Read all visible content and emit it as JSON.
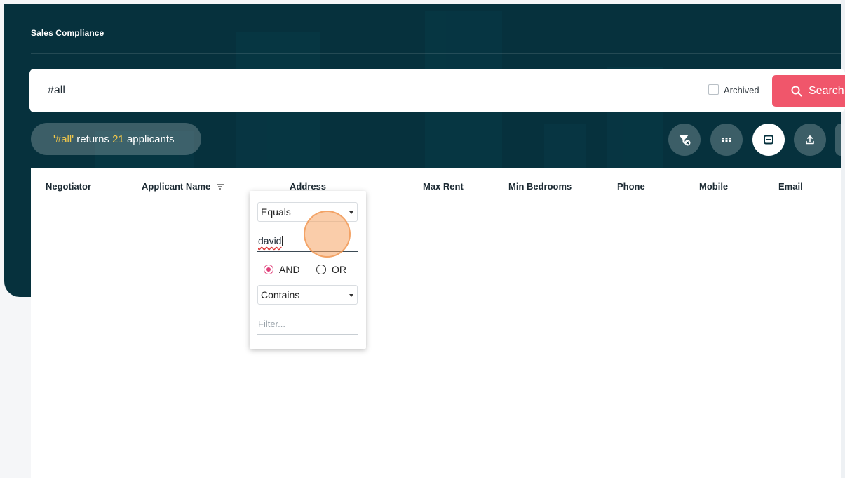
{
  "page": {
    "title": "Sales Compliance"
  },
  "search": {
    "query": "#all",
    "archived_label": "Archived",
    "button_label": "Search"
  },
  "result": {
    "query_text": "'#all'",
    "middle": " returns ",
    "count": "21",
    "suffix": " applicants"
  },
  "table": {
    "columns": [
      "Negotiator",
      "Applicant Name",
      "Address",
      "Max Rent",
      "Min Bedrooms",
      "Phone",
      "Mobile",
      "Email"
    ]
  },
  "filter": {
    "condition1": "Equals",
    "value1": "david",
    "and_label": "AND",
    "or_label": "OR",
    "condition2": "Contains",
    "value2_placeholder": "Filter..."
  },
  "colors": {
    "header_bg": "#06313d",
    "accent": "#f0566b",
    "highlight": "#f5c94a",
    "radio": "#e0407a"
  }
}
